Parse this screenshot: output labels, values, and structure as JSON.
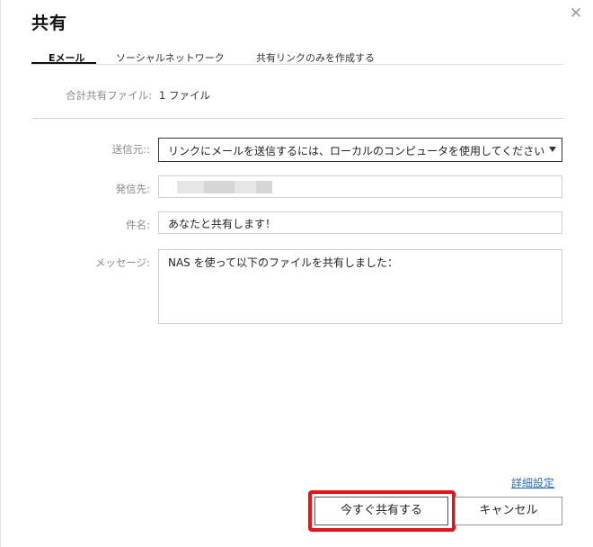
{
  "dialog": {
    "title": "共有",
    "close_glyph": "✕"
  },
  "tabs": [
    {
      "label": "Eメール",
      "active": true
    },
    {
      "label": "ソーシャルネットワーク",
      "active": false
    },
    {
      "label": "共有リンクのみを作成する",
      "active": false
    }
  ],
  "summary": {
    "label": "合計共有ファイル:",
    "value": "1 ファイル"
  },
  "form": {
    "from_label": "送信元::",
    "from_value": "リンクにメールを送信するには、ローカルのコンピュータを使用してください",
    "to_label": "発信先:",
    "to_value": "",
    "subject_label": "件名:",
    "subject_value": "あなたと共有します！",
    "message_label": "メッセージ:",
    "message_value": "NAS を使って以下のファイルを共有しました："
  },
  "footer": {
    "detail_link": "詳細設定",
    "share_now": "今すぐ共有する",
    "cancel": "キャンセル"
  },
  "colors": {
    "highlight": "#e8121b",
    "link": "#2a6fb5"
  }
}
